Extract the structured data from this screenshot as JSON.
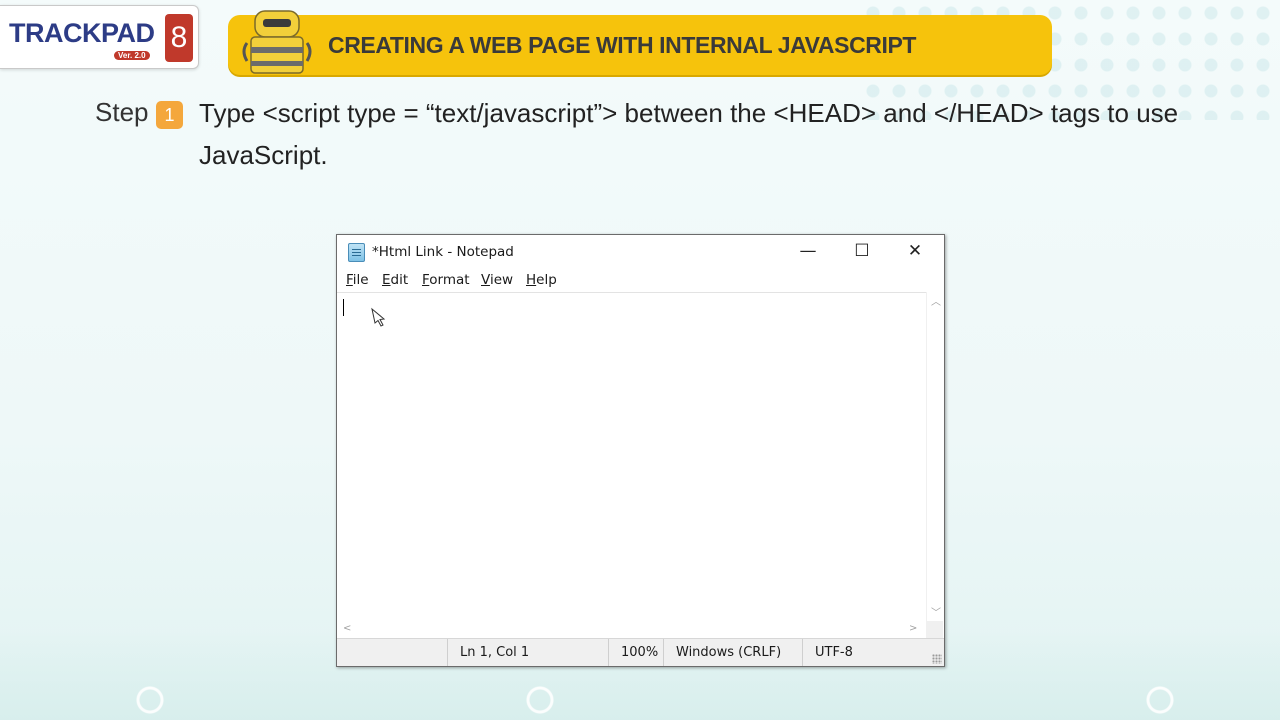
{
  "logo": {
    "word": "TRACKPAD",
    "version": "Ver. 2.0",
    "number": "8"
  },
  "banner": {
    "title": "CREATING A WEB PAGE WITH INTERNAL JAVASCRIPT"
  },
  "step": {
    "word": "Step",
    "number": "1",
    "text": "Type <script type = “text/javascript”> between the <HEAD> and </HEAD> tags to use JavaScript."
  },
  "notepad": {
    "title": "*Html Link - Notepad",
    "controls": {
      "minimize": "—",
      "maximize": "☐",
      "close": "✕"
    },
    "menu": {
      "file": {
        "accel": "F",
        "rest": "ile"
      },
      "edit": {
        "accel": "E",
        "rest": "dit"
      },
      "format": {
        "accel": "F",
        "rest": "ormat"
      },
      "view": {
        "accel": "V",
        "rest": "iew"
      },
      "help": {
        "accel": "H",
        "rest": "elp"
      }
    },
    "content": "",
    "status": {
      "position": "Ln 1, Col 1",
      "zoom": "100%",
      "line_ending": "Windows (CRLF)",
      "encoding": "UTF-8"
    }
  },
  "colors": {
    "banner": "#f6c30c",
    "step_badge": "#f4a73c",
    "logo_text": "#2d3c86",
    "logo_accent": "#c0392b"
  }
}
